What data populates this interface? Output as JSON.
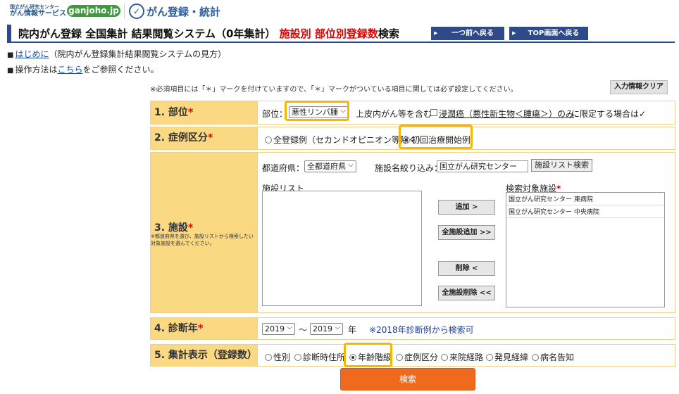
{
  "header": {
    "org_line1": "国立がん研究センター",
    "org_line2": "がん情報サービス",
    "pill": "ganjoho.jp",
    "emblem": "✓",
    "site_title": "がん登録・統計"
  },
  "title": {
    "main": "院内がん登録 全国集計 結果閲覧システム（0年集計）",
    "red": "施設別 部位別登録数",
    "suffix": "検索"
  },
  "nav": {
    "back": "一つ前へ戻る",
    "top": "TOP画面へ戻る"
  },
  "info": {
    "sq": "■",
    "link1": "はじめに",
    "text1": "（院内がん登録集計結果閲覧システムの見方）",
    "text2a": "操作方法は",
    "link2": "こちら",
    "text2b": "をご参照ください。"
  },
  "note": "※必須項目には「＊」マークを付けていますので、「＊」マークがついている項目に関しては必ず設定してください。",
  "clear_button": "入力情報クリア",
  "required_mark": "*",
  "site_row": {
    "label": "1. 部位",
    "prefix": "部位：",
    "select_value": "悪性リンパ腫",
    "text1": "上皮内がん等を含む",
    "link": "浸潤癌（悪性新生物＜腫瘍＞）のみ",
    "text2": "に限定する場合は✓"
  },
  "case_row": {
    "label": "2. 症例区分",
    "opt1": "全登録例（セカンドオピニオン等除く）",
    "opt2": "初回治療開始例"
  },
  "facility_row": {
    "label": "3. 施設",
    "help": "※都道府県を選び、施設リストから検索したい対象施設を選んでください。",
    "pref_label": "都道府県：",
    "pref_value": "全都道府県",
    "narrow_label": "施設名絞り込み：",
    "narrow_value": "国立がん研究センター",
    "list_search_btn": "施設リスト検索",
    "list_title": "施設リスト",
    "target_title": "検索対象施設",
    "targets": [
      "国立がん研究センター 東病院",
      "国立がん研究センター 中央病院"
    ],
    "btn_add": "追加 >",
    "btn_add_all": "全施設追加 >>",
    "btn_del": "削除 <",
    "btn_del_all": "全施設削除 <<"
  },
  "year_row": {
    "label": "4. 診断年",
    "from": "2019",
    "tilde": "〜",
    "to": "2019",
    "unit": "年",
    "note": "※2018年診断例から検索可"
  },
  "display_row": {
    "label": "5. 集計表示（登録数）",
    "options": [
      "性別",
      "診断時住所",
      "年齢階級",
      "症例区分",
      "来院経路",
      "発見経緯",
      "病名告知"
    ]
  },
  "search_button": "検索",
  "colors": {
    "navy": "#2f4a8a",
    "label_bg": "#fbd882",
    "highlight": "#f5b700",
    "search": "#f06a1e",
    "required": "#e00000"
  }
}
